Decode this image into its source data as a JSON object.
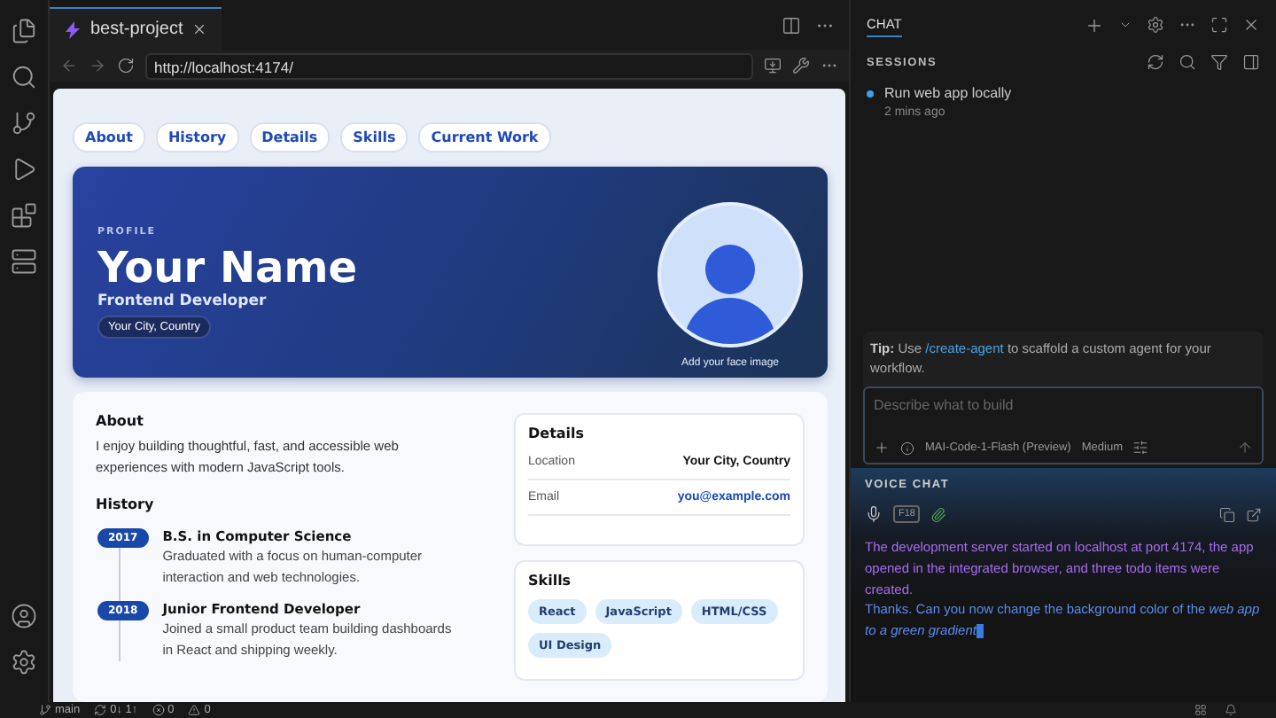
{
  "editor_tab": {
    "title": "best-project"
  },
  "address_bar": {
    "url": "http://localhost:4174/"
  },
  "page": {
    "nav": [
      "About",
      "History",
      "Details",
      "Skills",
      "Current Work"
    ],
    "hero": {
      "eyebrow": "PROFILE",
      "name": "Your Name",
      "role": "Frontend Developer",
      "location": "Your City, Country",
      "avatar_caption": "Add your face image"
    },
    "about": {
      "heading": "About",
      "text": "I enjoy building thoughtful, fast, and accessible web experiences with modern JavaScript tools."
    },
    "history": {
      "heading": "History",
      "items": [
        {
          "year": "2017",
          "title": "B.S. in Computer Science",
          "text": "Graduated with a focus on human-computer interaction and web technologies."
        },
        {
          "year": "2018",
          "title": "Junior Frontend Developer",
          "text": "Joined a small product team building dashboards in React and shipping weekly."
        }
      ]
    },
    "details": {
      "heading": "Details",
      "rows": [
        {
          "label": "Location",
          "value": "Your City, Country",
          "kind": "text"
        },
        {
          "label": "Email",
          "value": "you@example.com",
          "kind": "link"
        }
      ]
    },
    "skills": {
      "heading": "Skills",
      "tags": [
        "React",
        "JavaScript",
        "HTML/CSS",
        "UI Design"
      ]
    }
  },
  "chat": {
    "tab": "CHAT",
    "sessions_heading": "SESSIONS",
    "sessions": [
      {
        "title": "Run web app locally",
        "time": "2 mins ago"
      }
    ],
    "tip": {
      "label": "Tip:",
      "before": "Use",
      "command": "/create-agent",
      "after": "to scaffold a custom agent for your workflow."
    },
    "input": {
      "placeholder": "Describe what to build",
      "model": "MAI-Code-1-Flash (Preview)",
      "effort": "Medium"
    },
    "voice": {
      "heading": "VOICE CHAT",
      "badge": "F18",
      "messages": [
        {
          "kind": "assistant",
          "text": "The development server started on localhost at port 4174, the app opened in the integrated browser, and three todo items were created."
        },
        {
          "kind": "user",
          "text": "Thanks. Can you now change the background color of the *web app to a green gradient*"
        }
      ]
    }
  },
  "status_bar": {
    "branch": "main",
    "sync": "0↓ 1↑",
    "errors": "0",
    "warnings": "0"
  }
}
